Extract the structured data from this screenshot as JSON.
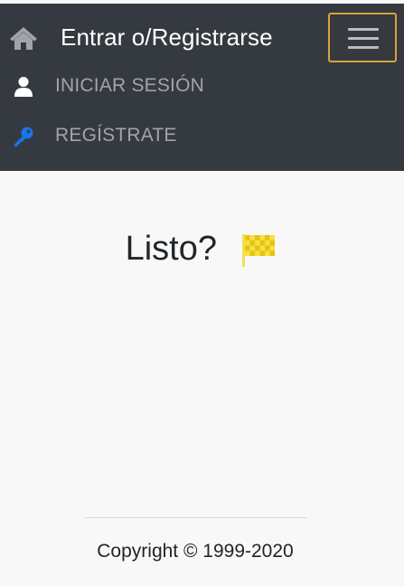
{
  "navbar": {
    "brand_title": "Entrar o/Registrarse",
    "home_icon": "home-icon",
    "menu_icon": "hamburger-menu-icon",
    "items": [
      {
        "label": "INICIAR SESIÓN",
        "icon": "user-icon"
      },
      {
        "label": "REGÍSTRATE",
        "icon": "key-icon"
      }
    ]
  },
  "main": {
    "heading": "Listo?",
    "heading_icon": "checkered-flag-icon"
  },
  "footer": {
    "copyright": "Copyright © 1999-2020"
  },
  "colors": {
    "navbar_bg": "#343a40",
    "toggler_border": "#d9a33a",
    "key_icon": "#1a73e8",
    "flag": "#f4e04d"
  }
}
